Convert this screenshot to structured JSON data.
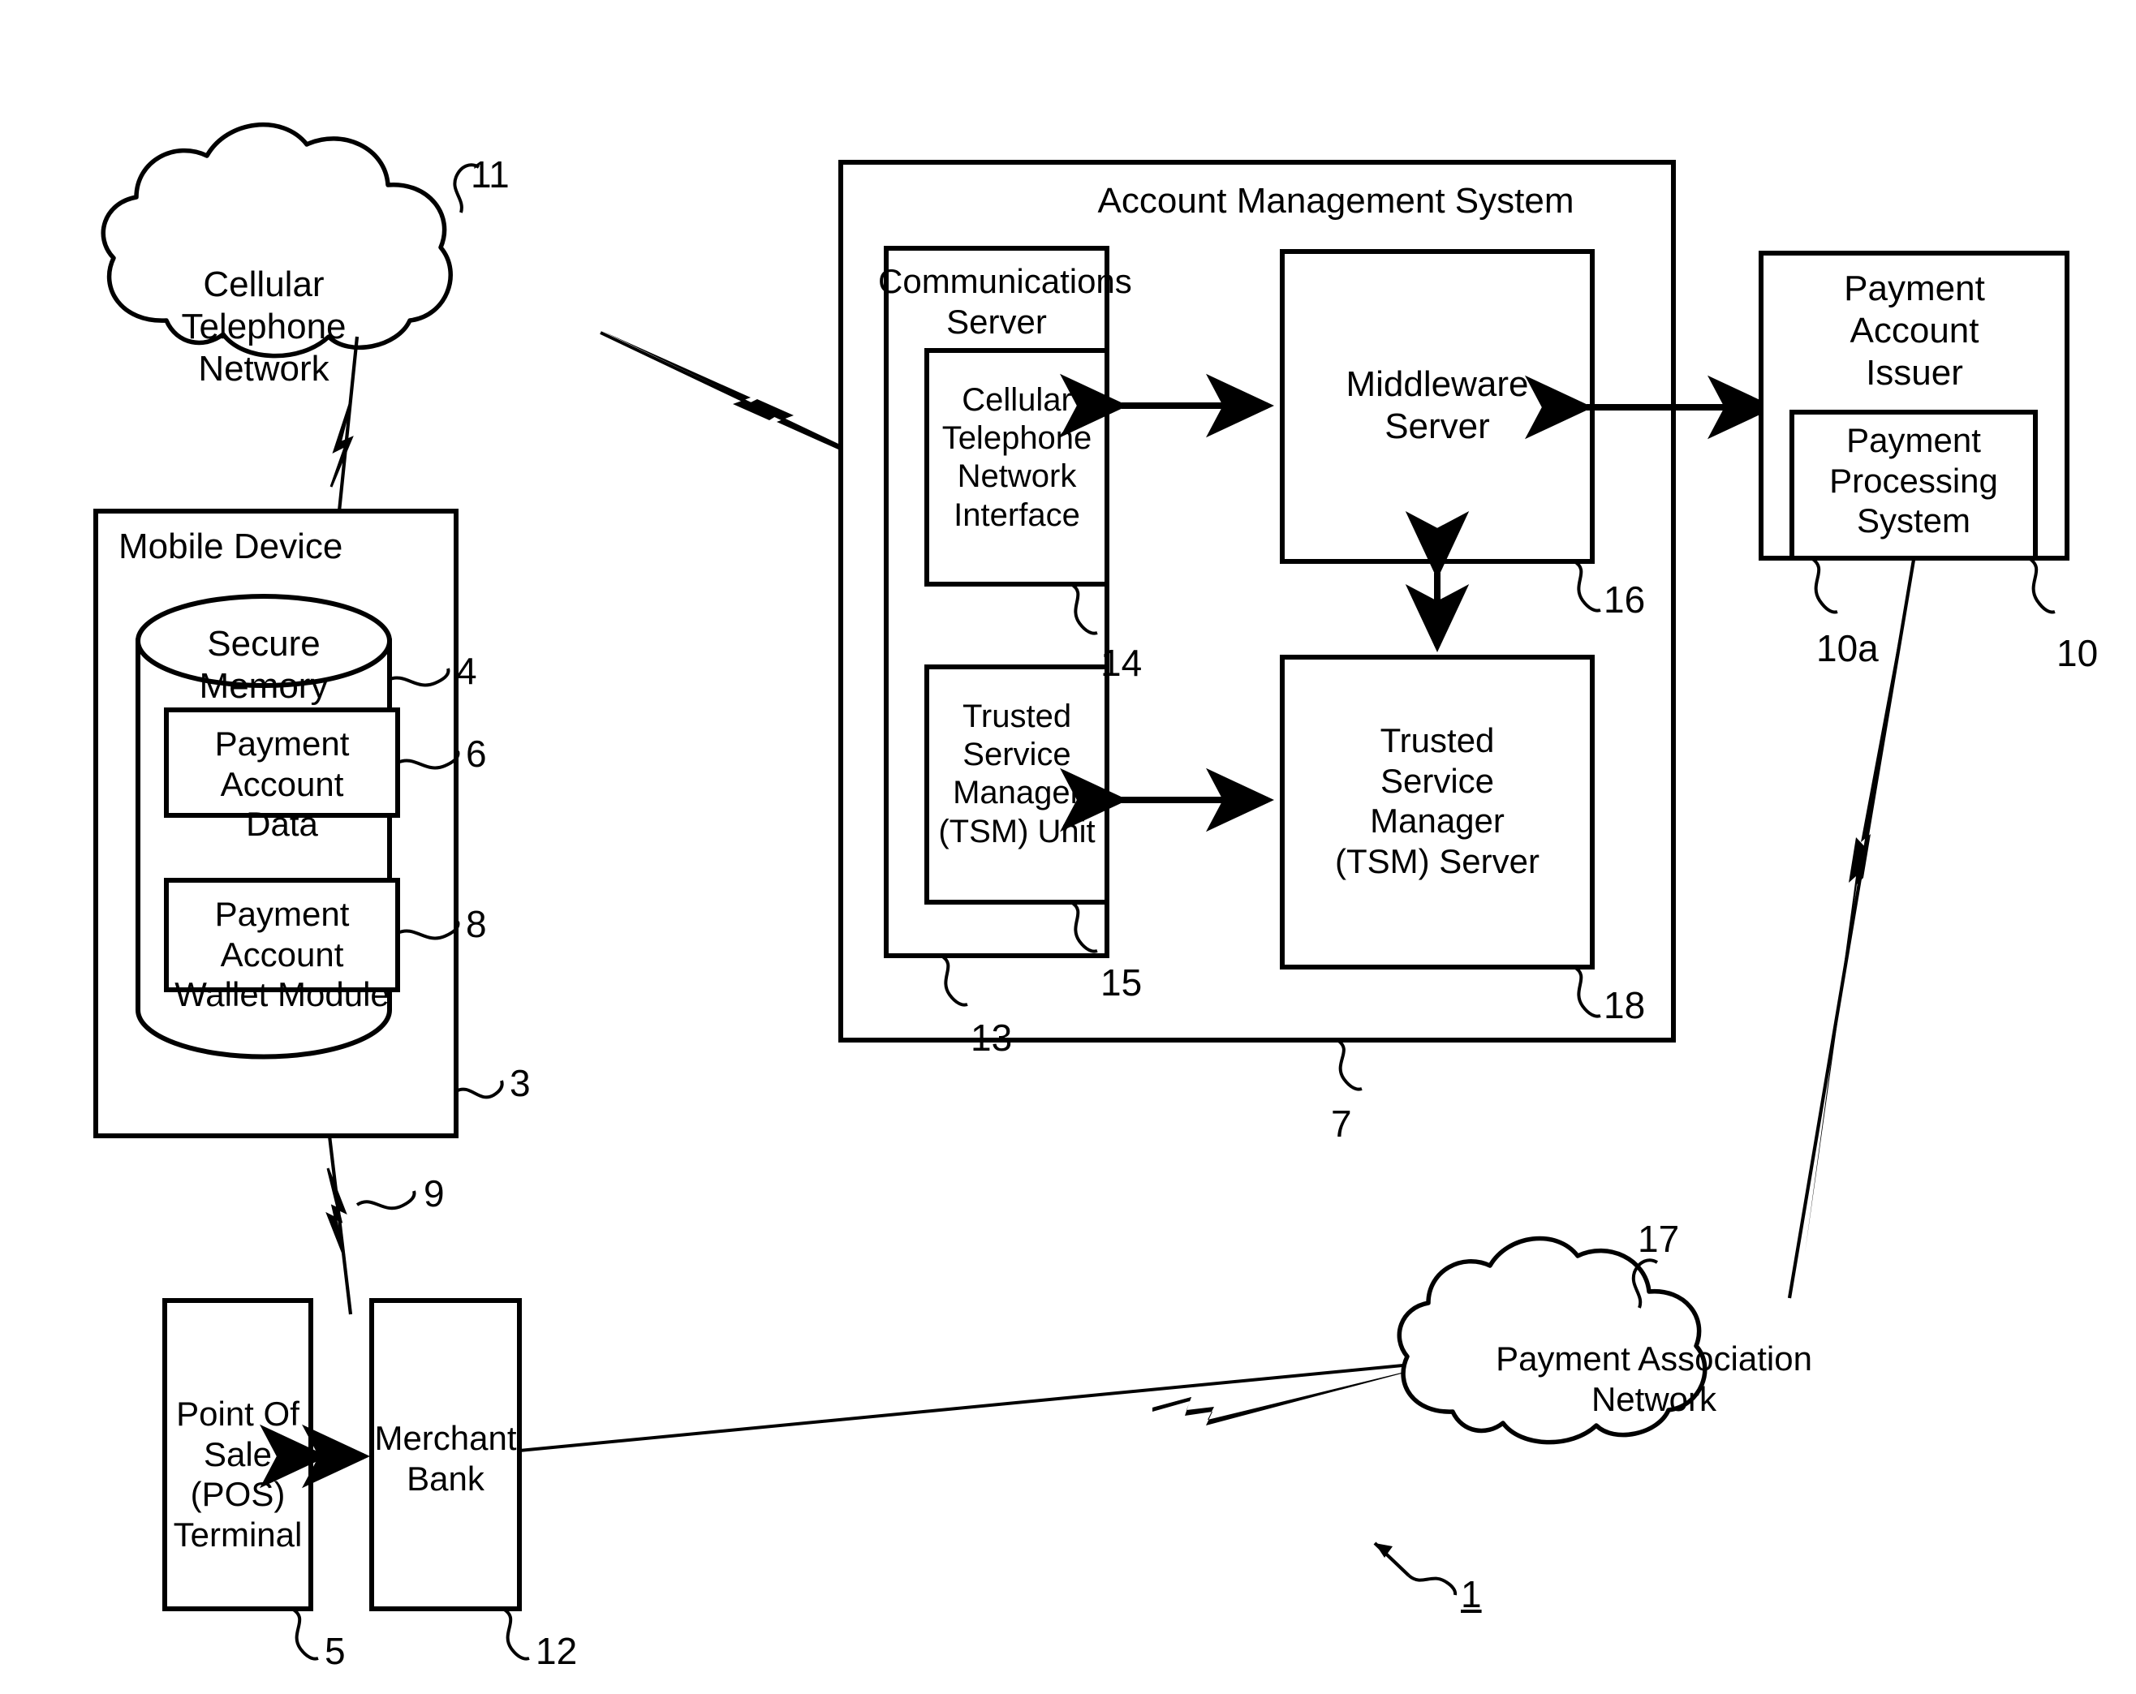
{
  "figure": {
    "type": "patent-block-diagram",
    "figure_ref": "1",
    "background": "#ffffff",
    "stroke": "#000000"
  },
  "nodes": {
    "cellular_network": {
      "label": "Cellular\nTelephone\nNetwork",
      "ref": "11",
      "shape": "cloud"
    },
    "mobile_device": {
      "label": "Mobile Device",
      "ref": "3",
      "shape": "rect"
    },
    "secure_memory": {
      "label": "Secure Memory",
      "ref": "4",
      "shape": "cylinder"
    },
    "payment_account_data": {
      "label": "Payment Account\nData",
      "ref": "6",
      "shape": "rect"
    },
    "payment_account_wallet_module": {
      "label": "Payment Account\nWallet Module",
      "ref": "8",
      "shape": "rect"
    },
    "account_management_system": {
      "label": "Account Management System",
      "ref": "7",
      "shape": "rect"
    },
    "communications_server": {
      "label": "Communications\nServer",
      "ref": "13",
      "shape": "rect"
    },
    "cellular_telephone_network_interface": {
      "label": "Cellular\nTelephone\nNetwork\nInterface",
      "ref": "14",
      "shape": "rect"
    },
    "tsm_unit": {
      "label": "Trusted\nService\nManager\n(TSM) Unit",
      "ref": "15",
      "shape": "rect"
    },
    "middleware_server": {
      "label": "Middleware\nServer",
      "ref": "16",
      "shape": "rect"
    },
    "tsm_server": {
      "label": "Trusted\nService\nManager\n(TSM) Server",
      "ref": "18",
      "shape": "rect"
    },
    "payment_account_issuer": {
      "label": "Payment\nAccount\nIssuer",
      "ref": "10",
      "shape": "rect"
    },
    "payment_processing_system": {
      "label": "Payment\nProcessing\nSystem",
      "ref": "10a",
      "shape": "rect"
    },
    "pos_terminal": {
      "label": "Point Of Sale\n(POS)\nTerminal",
      "ref": "5",
      "shape": "rect"
    },
    "merchant_bank": {
      "label": "Merchant\nBank",
      "ref": "12",
      "shape": "rect"
    },
    "payment_association_network": {
      "label": "Payment Association\nNetwork",
      "ref": "17",
      "shape": "cloud"
    }
  },
  "connections": [
    {
      "from": "cellular_network",
      "to": "mobile_device",
      "style": "lightning",
      "ref": null
    },
    {
      "from": "cellular_network",
      "to": "cellular_telephone_network_interface",
      "style": "lightning",
      "ref": null
    },
    {
      "from": "mobile_device",
      "to": "pos_terminal",
      "style": "lightning",
      "ref": "9"
    },
    {
      "from": "communications_server",
      "to": "middleware_server",
      "style": "double-arrow",
      "ref": null
    },
    {
      "from": "tsm_unit",
      "to": "tsm_server",
      "style": "double-arrow",
      "ref": null
    },
    {
      "from": "middleware_server",
      "to": "tsm_server",
      "style": "double-arrow-vertical",
      "ref": null
    },
    {
      "from": "middleware_server",
      "to": "payment_account_issuer",
      "style": "double-arrow",
      "ref": null
    },
    {
      "from": "pos_terminal",
      "to": "merchant_bank",
      "style": "double-arrow",
      "ref": null
    },
    {
      "from": "merchant_bank",
      "to": "payment_association_network",
      "style": "lightning",
      "ref": null
    },
    {
      "from": "payment_account_issuer",
      "to": "payment_association_network",
      "style": "lightning",
      "ref": null
    }
  ],
  "reference_numerals": [
    "11",
    "4",
    "6",
    "8",
    "3",
    "14",
    "15",
    "13",
    "16",
    "18",
    "7",
    "10a",
    "10",
    "9",
    "5",
    "12",
    "17",
    "1"
  ]
}
